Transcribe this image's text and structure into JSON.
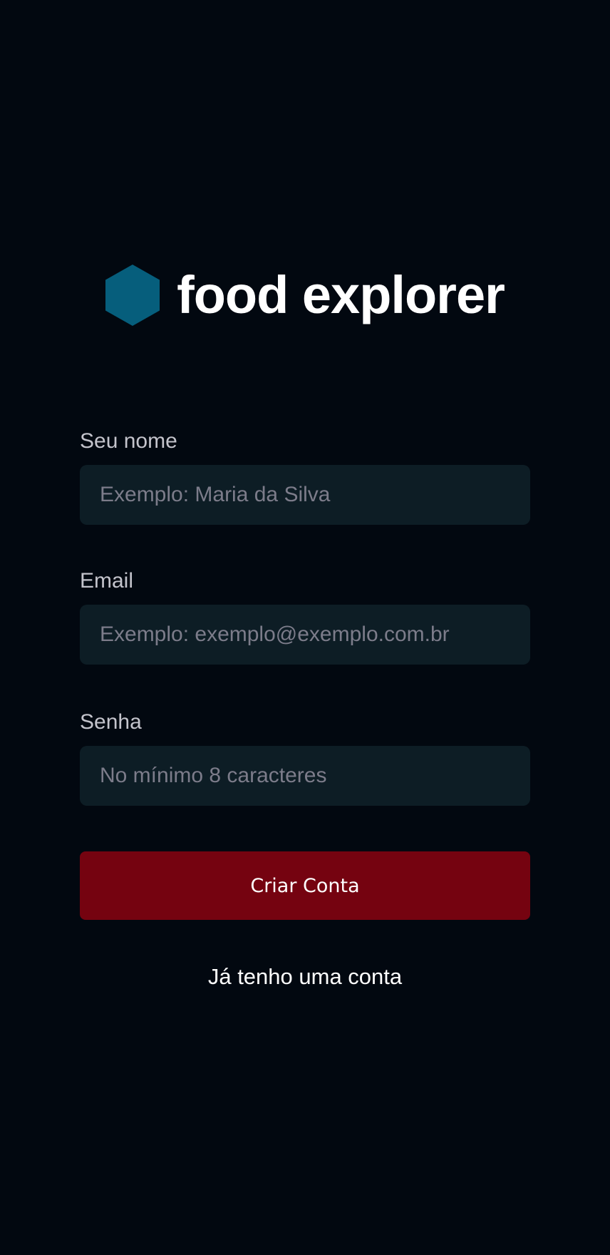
{
  "brand": {
    "name": "food explorer",
    "icon": "hexagon-icon",
    "icon_color": "#065E7C"
  },
  "form": {
    "name": {
      "label": "Seu nome",
      "placeholder": "Exemplo: Maria da Silva",
      "value": ""
    },
    "email": {
      "label": "Email",
      "placeholder": "Exemplo: exemplo@exemplo.com.br",
      "value": ""
    },
    "password": {
      "label": "Senha",
      "placeholder": "No mínimo 8 caracteres",
      "value": ""
    },
    "submit_label": "Criar Conta"
  },
  "login_link_label": "Já tenho uma conta",
  "colors": {
    "background": "#020810",
    "input_background": "#0D1D25",
    "button": "#750310",
    "label": "#C4C4CC",
    "placeholder": "#7C7C8A"
  }
}
